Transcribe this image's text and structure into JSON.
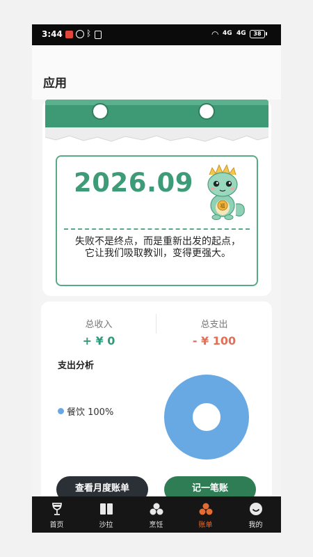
{
  "status_bar": {
    "time": "3:44",
    "signal_1": "4G",
    "signal_2": "4G",
    "battery": "38"
  },
  "header": {
    "title": "应用"
  },
  "calendar": {
    "date": "2026.09",
    "quote": "失败不是终点，而是重新出发的起点，它让我们吸取教训，变得更强大。",
    "mascot": "dragon-mascot"
  },
  "summary": {
    "income_label": "总收入",
    "income_value": "+ ¥ 0",
    "expense_label": "总支出",
    "expense_value": "- ¥ 100",
    "analysis_title": "支出分析",
    "legend": [
      {
        "label": "餐饮 100%",
        "color": "#68a9e3"
      }
    ],
    "chart_data": {
      "type": "pie",
      "categories": [
        "餐饮"
      ],
      "values": [
        100
      ],
      "title": "支出分析"
    },
    "btn_monthly": "查看月度账单",
    "btn_record": "记一笔账"
  },
  "colors": {
    "accent_green": "#3e9b77",
    "income_green": "#2f9a7a",
    "expense_red": "#e07058",
    "active_orange": "#e56a33"
  },
  "nav": [
    {
      "label": "首页",
      "icon": "wine-glass-icon"
    },
    {
      "label": "沙拉",
      "icon": "book-icon"
    },
    {
      "label": "烹饪",
      "icon": "dots-cluster-icon"
    },
    {
      "label": "账单",
      "icon": "bill-dots-icon",
      "active": true
    },
    {
      "label": "我的",
      "icon": "smiley-icon"
    }
  ]
}
